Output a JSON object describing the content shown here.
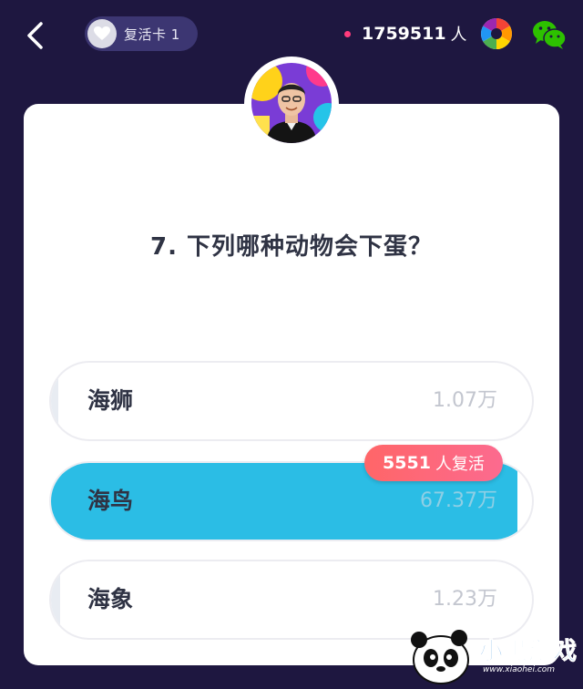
{
  "header": {
    "revive_label": "复活卡 1",
    "online_count": "1759511",
    "online_unit": "人"
  },
  "quiz": {
    "question": "7. 下列哪种动物会下蛋？",
    "options": [
      {
        "label": "海狮",
        "count": "1.07万",
        "share": 0.016
      },
      {
        "label": "海鸟",
        "count": "67.37万",
        "share": 0.97,
        "selected": true
      },
      {
        "label": "海象",
        "count": "1.23万",
        "share": 0.018
      }
    ],
    "revive_badge": {
      "number": "5551",
      "text": "人复活"
    }
  },
  "watermark": {
    "title": "小黑游戏",
    "subtitle": "www.xiaohei.com"
  },
  "colors": {
    "background": "#1e1740",
    "accent": "#2bbde5",
    "badge": "#ff6668"
  }
}
